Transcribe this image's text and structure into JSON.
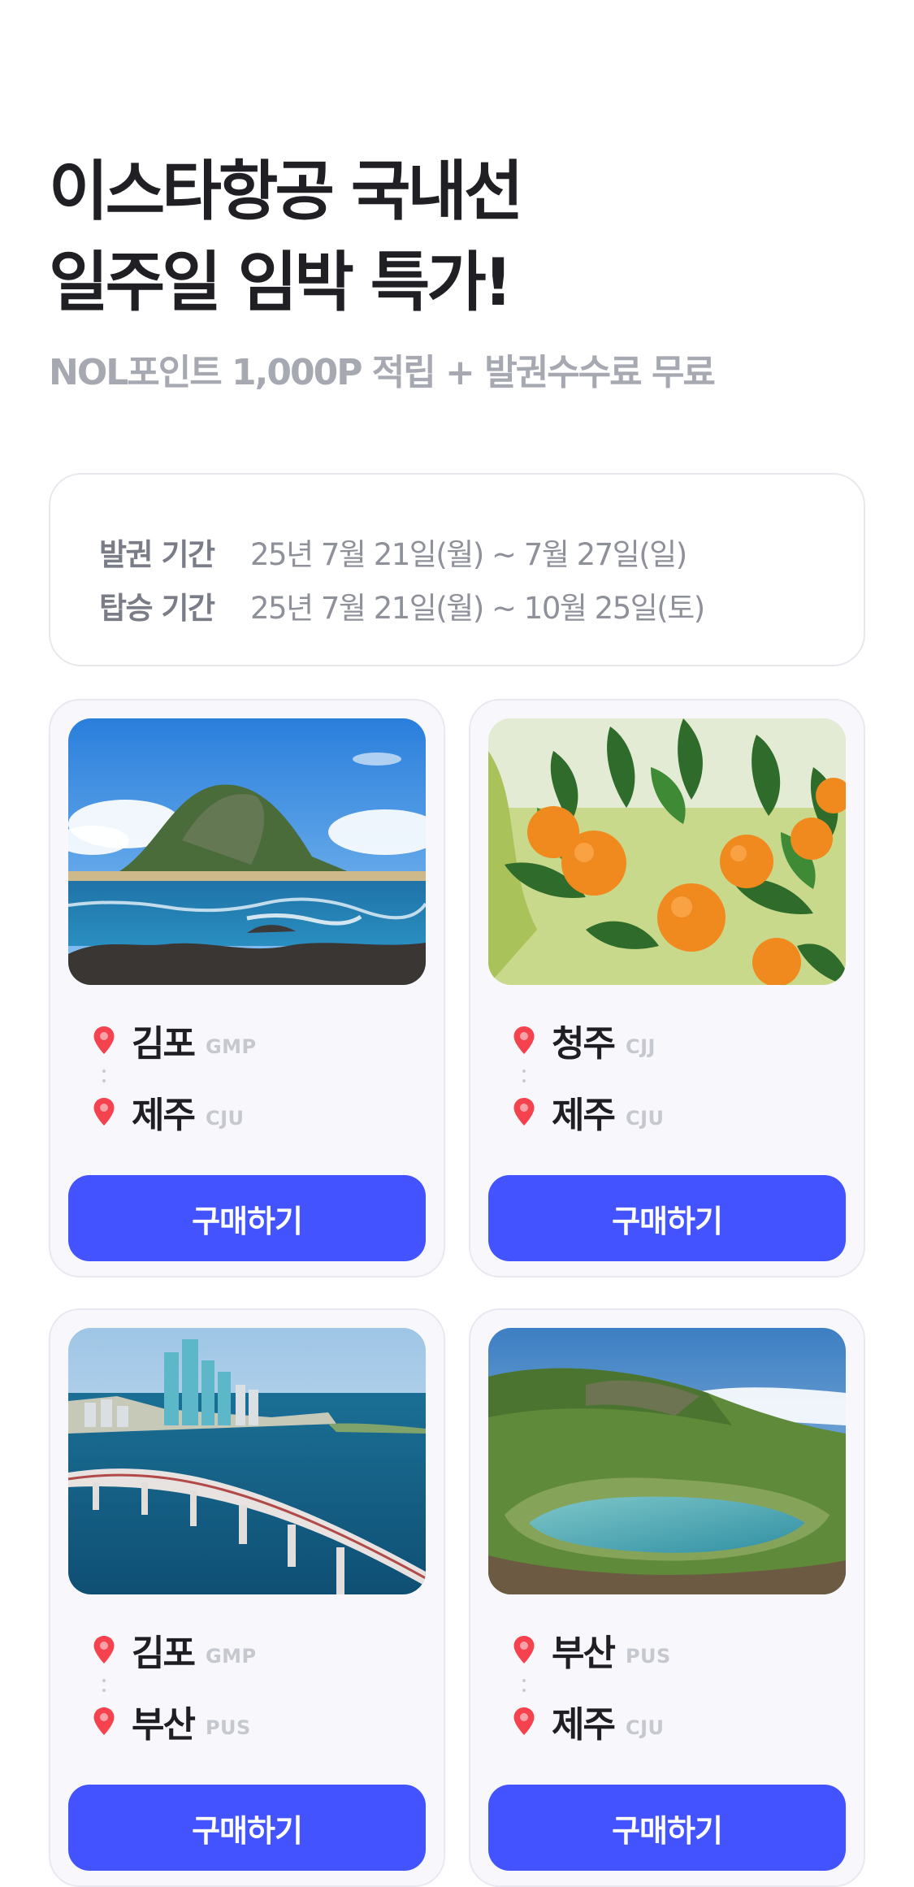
{
  "hero": {
    "title_line1": "이스타항공 국내선",
    "title_line2": "일주일 임박 특가!",
    "subtitle": "NOL포인트 1,000P 적립 + 발권수수료 무료"
  },
  "periods": [
    {
      "label": "발권 기간",
      "value": "25년 7월 21일(월) ~ 7월 27일(일)"
    },
    {
      "label": "탑승 기간",
      "value": "25년 7월 21일(월) ~ 10월 25일(토)"
    }
  ],
  "cards": [
    {
      "image": "jeju-seongsan-coast",
      "from_city": "김포",
      "from_code": "GMP",
      "to_city": "제주",
      "to_code": "CJU",
      "button": "구매하기"
    },
    {
      "image": "tangerine-tree",
      "from_city": "청주",
      "from_code": "CJJ",
      "to_city": "제주",
      "to_code": "CJU",
      "button": "구매하기"
    },
    {
      "image": "busan-skyline-bridge",
      "from_city": "김포",
      "from_code": "GMP",
      "to_city": "부산",
      "to_code": "PUS",
      "button": "구매하기"
    },
    {
      "image": "hallasan-crater-lake",
      "from_city": "부산",
      "from_code": "PUS",
      "to_city": "제주",
      "to_code": "CJU",
      "button": "구매하기"
    }
  ],
  "icons": {
    "pin": "location-pin-icon"
  },
  "colors": {
    "accent": "#4353ff",
    "pin": "#f4434f",
    "card_bg": "#f8f8fc"
  }
}
